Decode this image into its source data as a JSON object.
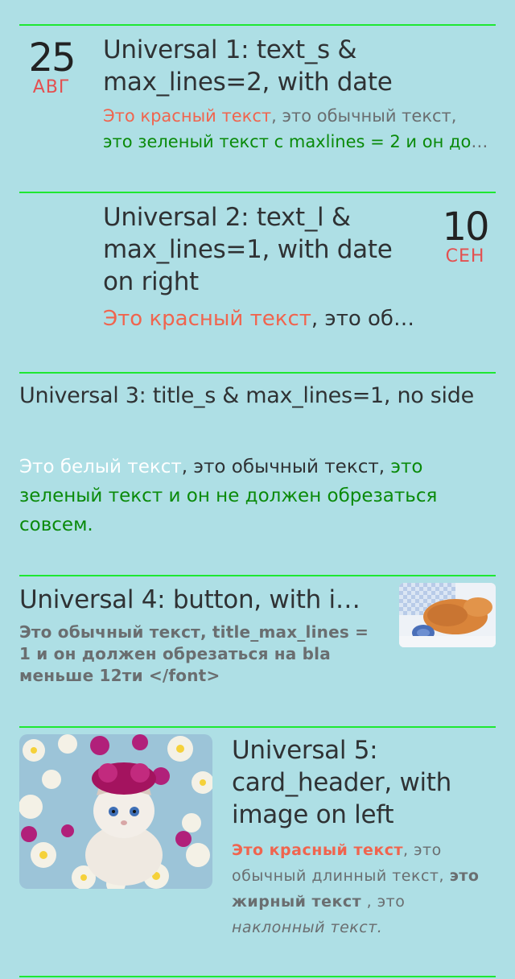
{
  "card1": {
    "title": "Universal 1: text_s & max_lines=2, with date",
    "date_day": "25",
    "date_month": "АВГ",
    "text_red": "Это красный текст",
    "text_normal": ", это обычный текст, ",
    "text_green": "это зеленый текст с maxlines = 2 и он должен обрезаться"
  },
  "card2": {
    "title": "Universal 2: text_l & max_lines=1, with date on right",
    "date_day": "10",
    "date_month": "СЕН",
    "text_red": "Это красный текст",
    "text_normal": ", это обычный текст"
  },
  "card3": {
    "title": "Universal 3: title_s & max_lines=1, no side",
    "text_white": "Это белый текст",
    "text_normal": ", это обычный текст, ",
    "text_green": "это зеленый текст и он не должен обрезаться совсем."
  },
  "card4": {
    "title": "Universal 4: button, with image on right",
    "text": "Это обычный текст, title_max_lines = 1 и он должен обрезаться на bla меньше 12ти </font>",
    "image_icon": "sleeping-kitten-image"
  },
  "card5": {
    "title": "Universal 5: card_header, with image on left",
    "text_red": "Это красный текст",
    "text_normal1": ", это обычный длинный текст, ",
    "text_bold": "это жирный текст",
    "text_normal2": " , это ",
    "text_italic": "наклонный текст.",
    "image_icon": "kitten-flowers-image"
  },
  "colors": {
    "background": "#aedfe5",
    "separator": "#1ee832",
    "red": "#f0644e",
    "green": "#0a8a0a",
    "date_month": "#e45050"
  }
}
